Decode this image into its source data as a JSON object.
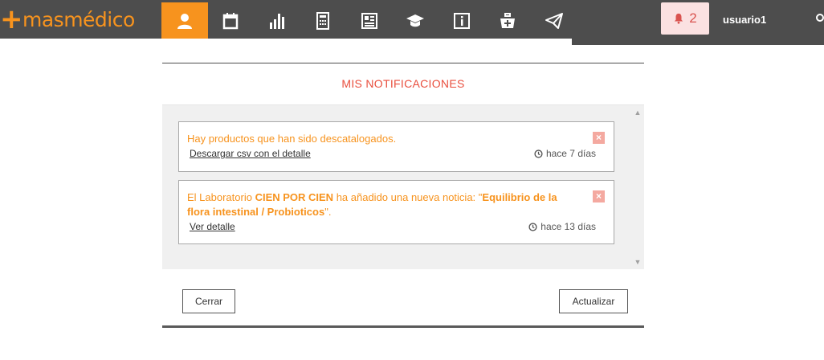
{
  "header": {
    "logo_plus": "+",
    "logo_mas": "mas",
    "logo_medico": "médico",
    "brand_color": "#f7931e",
    "nav": [
      {
        "icon": "user-icon",
        "active": true
      },
      {
        "icon": "calendar-icon",
        "active": false
      },
      {
        "icon": "bar-chart-icon",
        "active": false
      },
      {
        "icon": "calculator-icon",
        "active": false
      },
      {
        "icon": "newspaper-icon",
        "active": false
      },
      {
        "icon": "graduation-cap-icon",
        "active": false
      },
      {
        "icon": "info-icon",
        "active": false
      },
      {
        "icon": "medical-kit-icon",
        "active": false
      },
      {
        "icon": "send-icon",
        "active": false
      }
    ],
    "notifications_count": "2",
    "username": "usuario1"
  },
  "modal": {
    "title": "MIS NOTIFICACIONES",
    "notifications": [
      {
        "message": "Hay productos que han sido descatalogados.",
        "link": "Descargar csv con el detalle",
        "time": "hace 7 días"
      },
      {
        "message_prefix": "El Laboratorio ",
        "lab": "CIEN POR CIEN",
        "message_middle": " ha añadido una nueva noticia: \"",
        "news_title": "Equilibrio de la flora intestinal / Probioticos",
        "message_suffix": "\".",
        "link": "Ver detalle",
        "time": "hace 13 días"
      }
    ],
    "close_label": "Cerrar",
    "refresh_label": "Actualizar"
  }
}
